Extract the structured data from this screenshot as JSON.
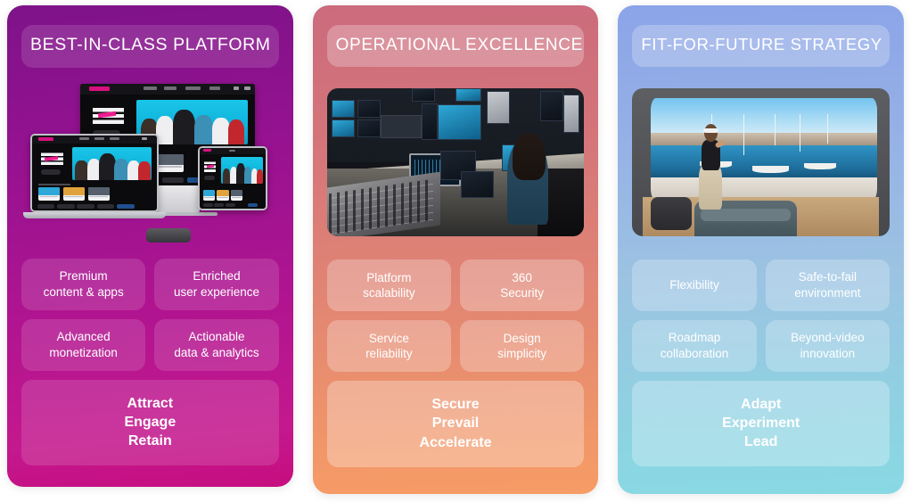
{
  "columns": [
    {
      "id": "best-in-class-platform",
      "header": "BEST-IN-CLASS PLATFORM",
      "media_alt": "streaming-platform-devices-mockup",
      "media_caption": "TV, laptop, tablet and set-top box showing a streaming app with a show hero banner",
      "pills": [
        {
          "line1": "Premium",
          "line2": "content & apps"
        },
        {
          "line1": "Enriched",
          "line2": "user experience"
        },
        {
          "line1": "Advanced",
          "line2": "monetization"
        },
        {
          "line1": "Actionable",
          "line2": "data & analytics"
        }
      ],
      "summary": [
        "Attract",
        "Engage",
        "Retain"
      ],
      "colors": {
        "top": "#7e1389",
        "bottom": "#c60d7f"
      }
    },
    {
      "id": "operational-excellence",
      "header": "OPERATIONAL EXCELLENCE",
      "media_alt": "broadcast-control-room-photo",
      "media_caption": "Operator at a broadcast control room desk with mixing console and monitor wall",
      "pills": [
        {
          "line1": "Platform",
          "line2": "scalability"
        },
        {
          "line1": "360",
          "line2": "Security"
        },
        {
          "line1": "Service",
          "line2": "reliability"
        },
        {
          "line1": "Design",
          "line2": "simplicity"
        }
      ],
      "summary": [
        "Secure",
        "Prevail",
        "Accelerate"
      ],
      "colors": {
        "top": "#cb6b7c",
        "bottom": "#f79c66"
      }
    },
    {
      "id": "fit-for-future-strategy",
      "header": "FIT-FOR-FUTURE STRATEGY",
      "media_alt": "immersive-vr-living-room-photo",
      "media_caption": "Woman wearing a VR headset in a living room with a curved screen showing a marina panorama",
      "pills": [
        {
          "line1": "Flexibility",
          "line2": ""
        },
        {
          "line1": "Safe-to-fail",
          "line2": "environment"
        },
        {
          "line1": "Roadmap",
          "line2": "collaboration"
        },
        {
          "line1": "Beyond-video",
          "line2": "innovation"
        }
      ],
      "summary": [
        "Adapt",
        "Experiment",
        "Lead"
      ],
      "colors": {
        "top": "#8ba4e8",
        "bottom": "#88d9e3"
      }
    }
  ]
}
